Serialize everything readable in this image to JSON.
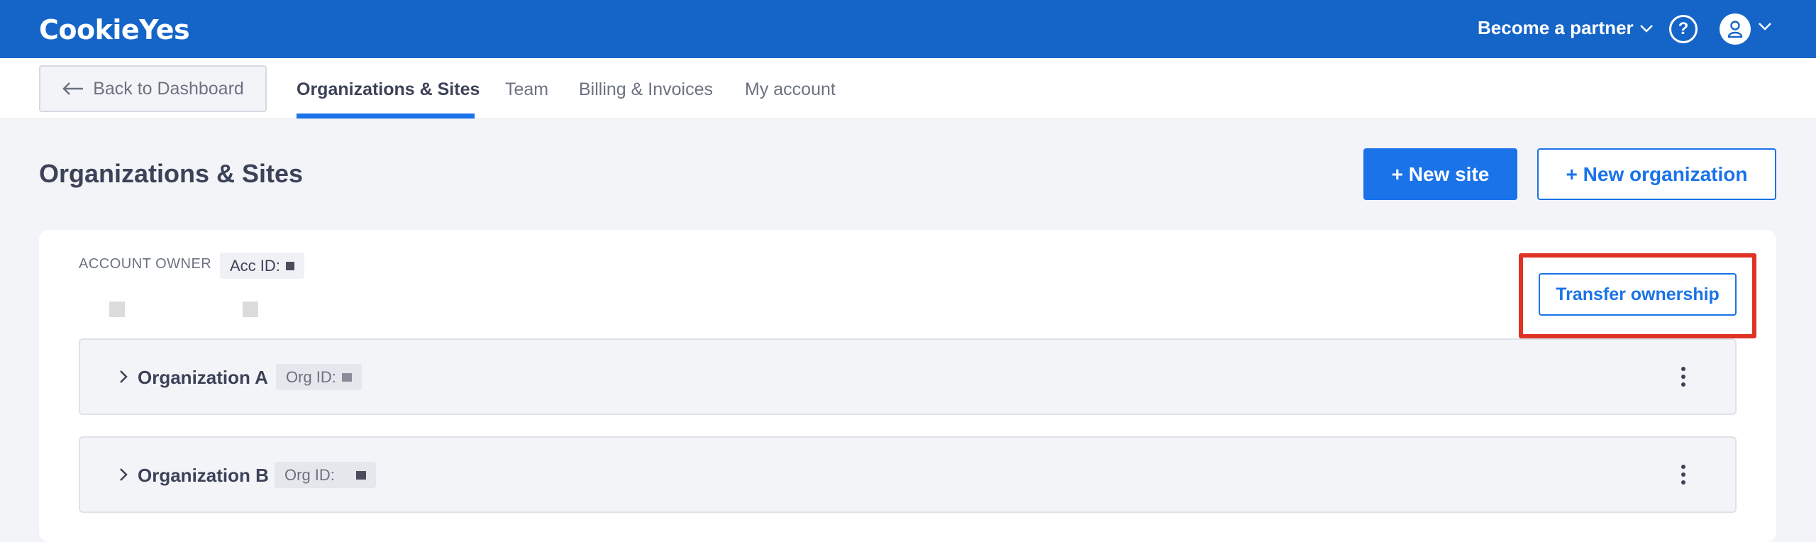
{
  "header": {
    "logo": "CookieYes",
    "partner_label": "Become a partner",
    "help_label": "?"
  },
  "subnav": {
    "back_label": "Back to Dashboard",
    "tabs": [
      {
        "label": "Organizations & Sites",
        "active": true
      },
      {
        "label": "Team",
        "active": false
      },
      {
        "label": "Billing & Invoices",
        "active": false
      },
      {
        "label": "My account",
        "active": false
      }
    ]
  },
  "page": {
    "title": "Organizations & Sites",
    "new_site_label": "+ New site",
    "new_org_label": "+ New organization"
  },
  "account": {
    "owner_label": "ACCOUNT OWNER",
    "acc_id_label": "Acc ID:",
    "transfer_label": "Transfer ownership"
  },
  "organizations": [
    {
      "name": "Organization A",
      "id_label": "Org ID:"
    },
    {
      "name": "Organization B",
      "id_label": "Org ID:"
    }
  ],
  "colors": {
    "brand_blue": "#1565c8",
    "accent_blue": "#1a73e8",
    "highlight_red": "#e03325"
  }
}
